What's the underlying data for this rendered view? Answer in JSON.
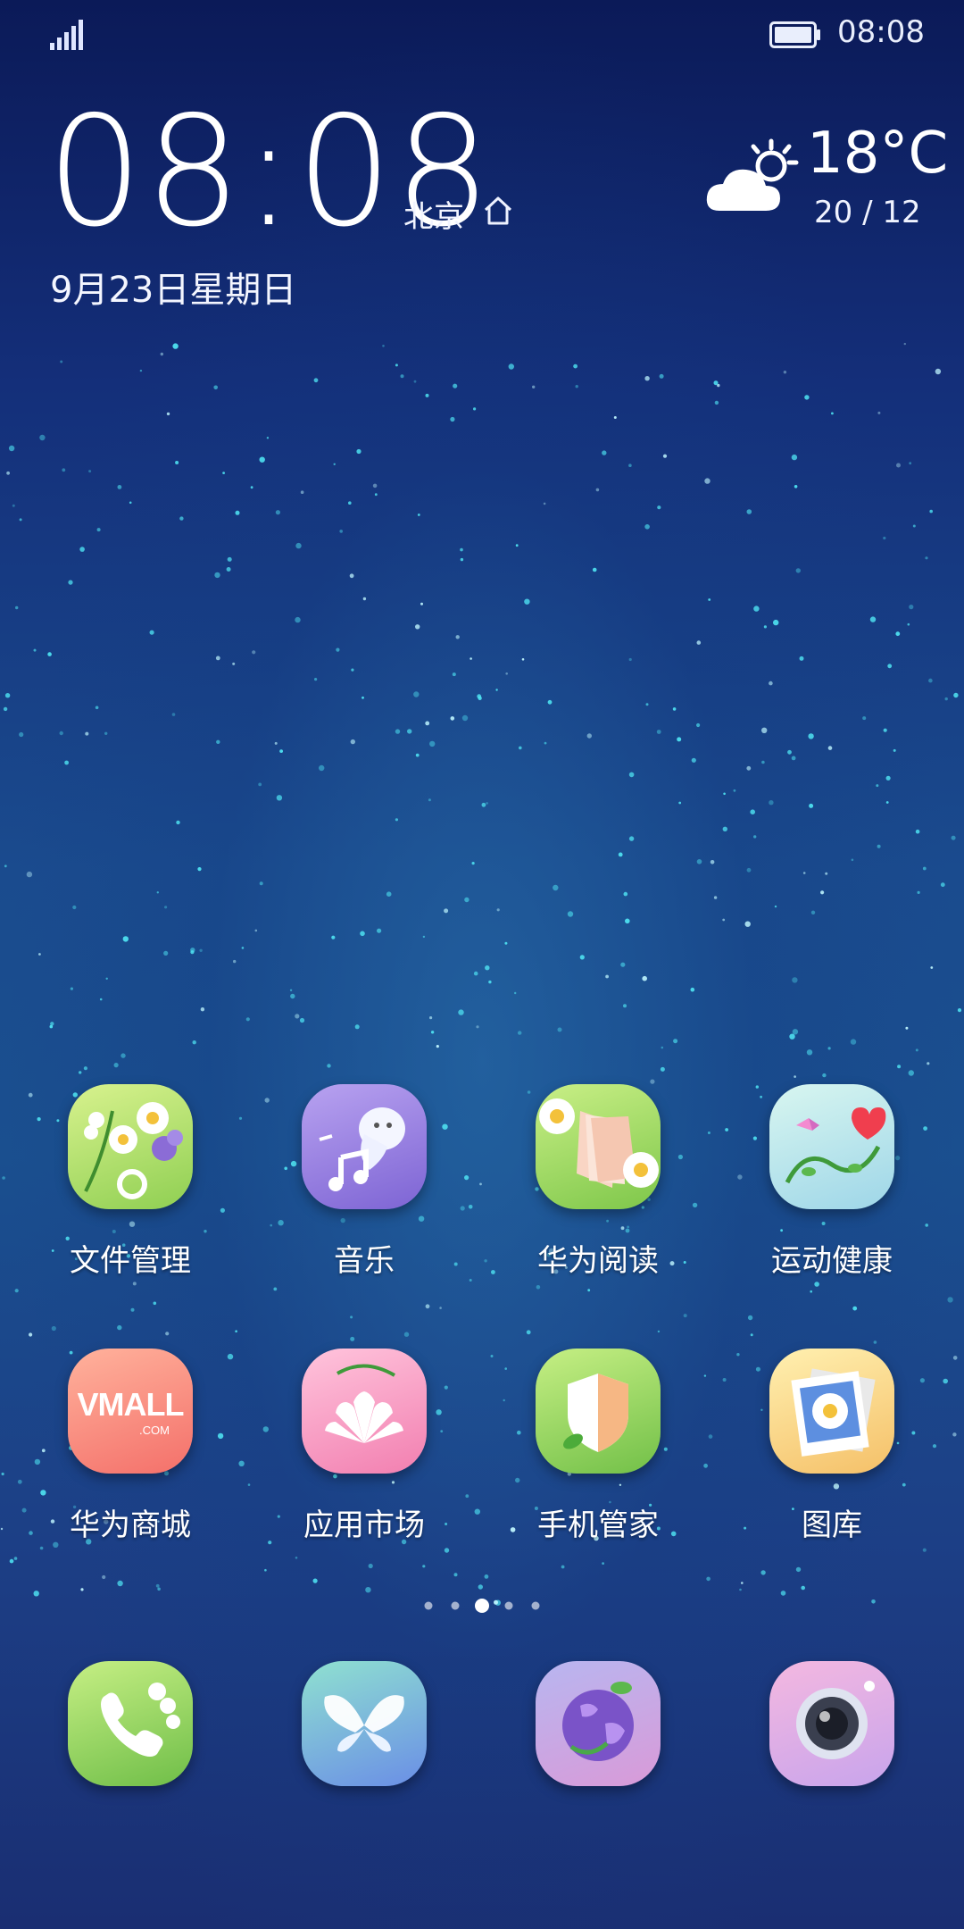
{
  "status_bar": {
    "time": "08:08",
    "signal_icon": "signal-icon",
    "battery_icon": "battery-icon"
  },
  "clock_widget": {
    "time": "08:08",
    "city": "北京",
    "date": "9月23日星期日",
    "home_icon": "home-icon"
  },
  "weather": {
    "temperature": "18°C",
    "range": "20 / 12",
    "icon": "partly-cloudy-icon"
  },
  "apps": [
    {
      "label": "文件管理",
      "icon": "file-manager-icon"
    },
    {
      "label": "音乐",
      "icon": "music-icon"
    },
    {
      "label": "华为阅读",
      "icon": "reading-icon"
    },
    {
      "label": "运动健康",
      "icon": "health-icon"
    },
    {
      "label": "华为商城",
      "icon": "vmall-icon",
      "icon_text": "VMALL",
      "icon_subtext": ".COM"
    },
    {
      "label": "应用市场",
      "icon": "app-market-icon"
    },
    {
      "label": "手机管家",
      "icon": "phone-manager-icon"
    },
    {
      "label": "图库",
      "icon": "gallery-icon"
    }
  ],
  "page_indicator": {
    "count": 5,
    "active_index": 2
  },
  "dock": [
    {
      "icon": "phone-icon"
    },
    {
      "icon": "messages-icon"
    },
    {
      "icon": "browser-icon"
    },
    {
      "icon": "camera-icon"
    }
  ]
}
